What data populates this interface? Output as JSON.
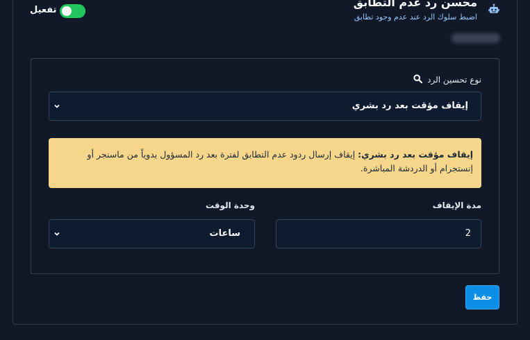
{
  "header": {
    "title": "محسن رد عدم التطابق",
    "subtitle": "اضبط سلوك الرد عند عدم وجود تطابق",
    "icon": "robot-icon"
  },
  "toggle": {
    "label": "تفعيل",
    "enabled": true,
    "color": "#22c55e"
  },
  "form": {
    "improvement_type": {
      "label": "نوع تحسين الرد",
      "selected": "إيقاف مؤقت بعد رد بشري"
    },
    "notice": {
      "bold": "إيقاف مؤقت بعد رد بشري:",
      "text": " إيقاف إرسال ردود عدم التطابق لفترة بعد رد المسؤول يدوياً من ماسنجر أو إنستجرام أو الدردشة المباشرة.",
      "color": "#f5d68b"
    },
    "pause_duration": {
      "label": "مدة الإيقاف",
      "value": "2"
    },
    "time_unit": {
      "label": "وحدة الوقت",
      "selected": "ساعات"
    }
  },
  "actions": {
    "save_label": "حفظ",
    "accent": "#0d8fe8"
  }
}
